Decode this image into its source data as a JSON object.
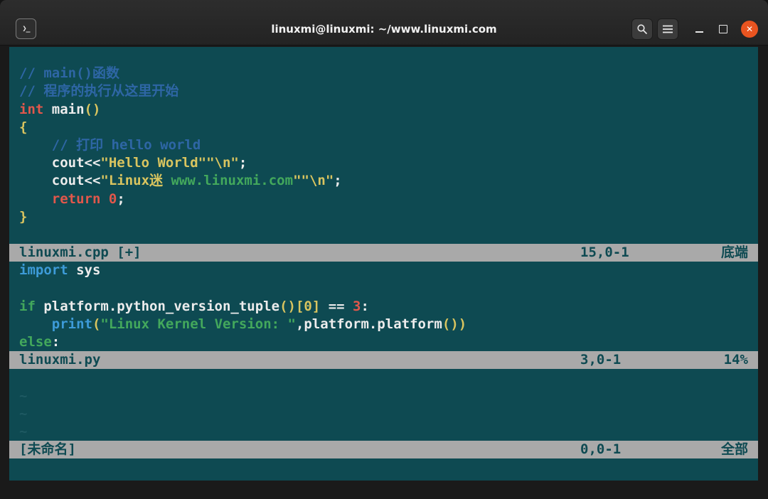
{
  "window": {
    "title": "linuxmi@linuxmi: ~/www.linuxmi.com",
    "app_icon_glyph": "❯_",
    "controls": {
      "close_glyph": "✕"
    }
  },
  "colors": {
    "terminal_bg": "#0e4a52",
    "titlebar_bg": "#262626",
    "statusbar_bg": "#a9a9a9",
    "statusbar_text": "#0e4a52",
    "close_button": "#e95420",
    "syntax_comment": "#2e66a5",
    "syntax_keyword_red": "#e2574b",
    "syntax_string_yellow": "#d9c45f",
    "syntax_green": "#43a85c",
    "syntax_blue": "#3d9bd8"
  },
  "vim": {
    "windows": [
      {
        "lines": [
          [],
          [
            {
              "t": "// main()函数",
              "c": "comment"
            }
          ],
          [
            {
              "t": "// 程序的执行从这里开始",
              "c": "comment"
            }
          ],
          [
            {
              "t": "int",
              "c": "red"
            },
            {
              "t": " ",
              "c": "plain"
            },
            {
              "t": "main",
              "c": "plain"
            },
            {
              "t": "()",
              "c": "yellow"
            }
          ],
          [
            {
              "t": "{",
              "c": "yellow"
            }
          ],
          [
            {
              "t": "    ",
              "c": "plain"
            },
            {
              "t": "// 打印 hello world",
              "c": "comment"
            }
          ],
          [
            {
              "t": "    cout<<",
              "c": "plain"
            },
            {
              "t": "\"Hello World\"\"\\n\"",
              "c": "yellow"
            },
            {
              "t": ";",
              "c": "plain"
            }
          ],
          [
            {
              "t": "    cout<<",
              "c": "plain"
            },
            {
              "t": "\"Linux迷 ",
              "c": "yellow"
            },
            {
              "t": "www.linuxmi.com",
              "c": "green"
            },
            {
              "t": "\"\"\\n\"",
              "c": "yellow"
            },
            {
              "t": ";",
              "c": "plain"
            }
          ],
          [
            {
              "t": "    ",
              "c": "plain"
            },
            {
              "t": "return",
              "c": "red"
            },
            {
              "t": " ",
              "c": "plain"
            },
            {
              "t": "0",
              "c": "red"
            },
            {
              "t": ";",
              "c": "plain"
            }
          ],
          [
            {
              "t": "}",
              "c": "yellow"
            }
          ],
          []
        ],
        "status": {
          "name": "linuxmi.cpp [+]",
          "ruler": "15,0-1",
          "position": "底端"
        }
      },
      {
        "lines": [
          [
            {
              "t": "import",
              "c": "blue"
            },
            {
              "t": " sys",
              "c": "plain"
            }
          ],
          [],
          [
            {
              "t": "if",
              "c": "green"
            },
            {
              "t": " platform.python_version_tuple",
              "c": "plain"
            },
            {
              "t": "()[0]",
              "c": "yellow"
            },
            {
              "t": " == ",
              "c": "plain"
            },
            {
              "t": "3",
              "c": "red"
            },
            {
              "t": ":",
              "c": "plain"
            }
          ],
          [
            {
              "t": "    ",
              "c": "plain"
            },
            {
              "t": "print",
              "c": "blue"
            },
            {
              "t": "(",
              "c": "yellow"
            },
            {
              "t": "\"Linux Kernel Version: \"",
              "c": "green"
            },
            {
              "t": ",platform.platform",
              "c": "plain"
            },
            {
              "t": "())",
              "c": "yellow"
            }
          ],
          [
            {
              "t": "else",
              "c": "green"
            },
            {
              "t": ":",
              "c": "plain"
            }
          ]
        ],
        "status": {
          "name": "linuxmi.py",
          "ruler": "3,0-1",
          "position": "14%"
        }
      },
      {
        "lines": [
          [],
          [
            {
              "t": "~",
              "c": "tilde"
            }
          ],
          [
            {
              "t": "~",
              "c": "tilde"
            }
          ],
          [
            {
              "t": "~",
              "c": "tilde"
            }
          ]
        ],
        "status": {
          "name": "[未命名]",
          "ruler": "0,0-1",
          "position": "全部"
        }
      }
    ]
  }
}
